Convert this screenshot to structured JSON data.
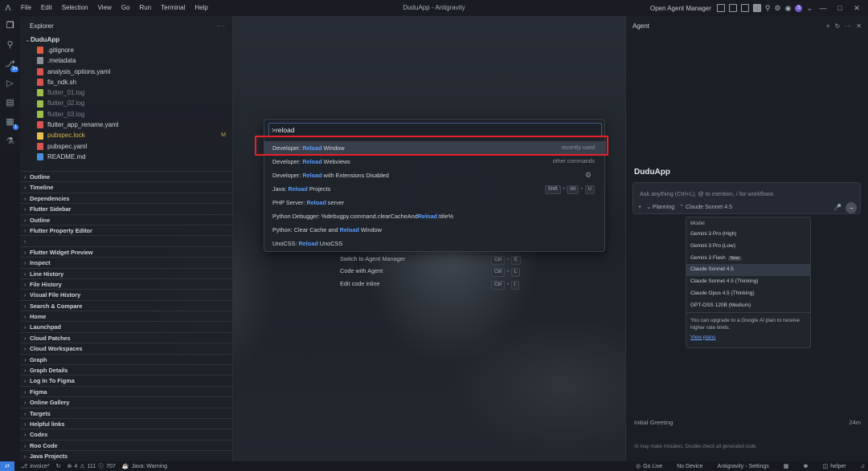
{
  "window": {
    "title": "DuduApp - Antigravity"
  },
  "menu": [
    "File",
    "Edit",
    "Selection",
    "View",
    "Go",
    "Run",
    "Terminal",
    "Help"
  ],
  "titlebar": {
    "open_agent_manager": "Open Agent Manager",
    "avatar_letter": "S"
  },
  "sidebar": {
    "title": "Explorer",
    "project": "DuduApp",
    "files": [
      {
        "name": ".gitignore",
        "color": "#e05d44",
        "text_color": "#cfd3da",
        "badge": ""
      },
      {
        "name": ".metadata",
        "color": "#8a909a",
        "text_color": "#cfd3da",
        "badge": ""
      },
      {
        "name": "analysis_options.yaml",
        "color": "#d9534f",
        "text_color": "#cfd3da",
        "badge": ""
      },
      {
        "name": "fix_ndk.sh",
        "color": "#d9534f",
        "text_color": "#cfd3da",
        "badge": ""
      },
      {
        "name": "flutter_01.log",
        "color": "#9bbf4a",
        "text_color": "#7d838c",
        "badge": ""
      },
      {
        "name": "flutter_02.log",
        "color": "#9bbf4a",
        "text_color": "#7d838c",
        "badge": ""
      },
      {
        "name": "flutter_03.log",
        "color": "#9bbf4a",
        "text_color": "#7d838c",
        "badge": ""
      },
      {
        "name": "flutter_app_rename.yaml",
        "color": "#d9534f",
        "text_color": "#cfd3da",
        "badge": ""
      },
      {
        "name": "pubspec.lock",
        "color": "#e8c14a",
        "text_color": "#d8b24a",
        "badge": "M"
      },
      {
        "name": "pubspec.yaml",
        "color": "#d9534f",
        "text_color": "#cfd3da",
        "badge": ""
      },
      {
        "name": "README.md",
        "color": "#4a8fd9",
        "text_color": "#cfd3da",
        "badge": ""
      }
    ],
    "sections": [
      "Outline",
      "Timeline",
      "Dependencies",
      "Flutter Sidebar",
      "Outline",
      "Flutter Property Editor",
      "",
      "Flutter Widget Preview",
      "Inspect",
      "Line History",
      "File History",
      "Visual File History",
      "Search & Compare",
      "Home",
      "Launchpad",
      "Cloud Patches",
      "Cloud Workspaces",
      "Graph",
      "Graph Details",
      "Log In To Figma",
      "Figma",
      "Online Gallery",
      "Targets",
      "Helpful links",
      "Codex",
      "Roo Code",
      "Java Projects"
    ]
  },
  "palette": {
    "input_value": ">reload",
    "items": [
      {
        "before": "Developer: ",
        "match": "Reload",
        "after": " Window",
        "right": "recently used",
        "keys": [],
        "icon": ""
      },
      {
        "before": "Developer: ",
        "match": "Reload",
        "after": " Webviews",
        "right": "other commands",
        "keys": [],
        "icon": ""
      },
      {
        "before": "Developer: ",
        "match": "Reload",
        "after": " with Extensions Disabled",
        "right": "",
        "keys": [],
        "icon": "gear"
      },
      {
        "before": "Java: ",
        "match": "Reload",
        "after": " Projects",
        "right": "",
        "keys": [
          "Shift",
          "Alt",
          "U"
        ],
        "icon": ""
      },
      {
        "before": "PHP Server: ",
        "match": "Reload",
        "after": " server",
        "right": "",
        "keys": [],
        "icon": ""
      },
      {
        "before": "Python Debugger: %debugpy.command.clearCacheAnd",
        "match": "Reload",
        "after": ".title%",
        "right": "",
        "keys": [],
        "icon": ""
      },
      {
        "before": "Python: Clear Cache and ",
        "match": "Reload",
        "after": " Window",
        "right": "",
        "keys": [],
        "icon": ""
      },
      {
        "before": "UnoCSS: ",
        "match": "Reload",
        "after": " UnoCSS",
        "right": "",
        "keys": [],
        "icon": ""
      }
    ]
  },
  "hints": [
    {
      "label": "Switch to Agent Manager",
      "keys": [
        "Ctrl",
        "E"
      ]
    },
    {
      "label": "Code with Agent",
      "keys": [
        "Ctrl",
        "L"
      ]
    },
    {
      "label": "Edit code inline",
      "keys": [
        "Ctrl",
        "I"
      ]
    }
  ],
  "agent": {
    "title": "Agent",
    "project": "DuduApp",
    "input_placeholder": "Ask anything (Ctrl+L), @ to mention, / for workflows",
    "mode": "Planning",
    "model": "Claude Sonnet 4.5",
    "model_menu": {
      "header": "Model",
      "items": [
        {
          "name": "Gemini 3 Pro (High)",
          "tag": "",
          "selected": false
        },
        {
          "name": "Gemini 3 Pro (Low)",
          "tag": "",
          "selected": false
        },
        {
          "name": "Gemini 3 Flash",
          "tag": "New",
          "selected": false
        },
        {
          "name": "Claude Sonnet 4.5",
          "tag": "",
          "selected": true
        },
        {
          "name": "Claude Sonnet 4.5 (Thinking)",
          "tag": "",
          "selected": false
        },
        {
          "name": "Claude Opus 4.5 (Thinking)",
          "tag": "",
          "selected": false
        },
        {
          "name": "GPT-OSS 120B (Medium)",
          "tag": "",
          "selected": false
        }
      ],
      "footer": "You can upgrade to a Google AI plan to receive higher rate limits.",
      "link": "View plans"
    },
    "initial_greeting": "Initial Greeting",
    "greeting_time": "24m",
    "disclaimer": "AI may make mistakes. Double-check all generated code."
  },
  "statusbar": {
    "branch": "invoice*",
    "errors": "4",
    "warnings": "111",
    "info": "707",
    "java": "Java: Warning",
    "go_live": "Go Live",
    "device": "No Device",
    "settings": "Antigravity - Settings",
    "helper": "helper"
  }
}
